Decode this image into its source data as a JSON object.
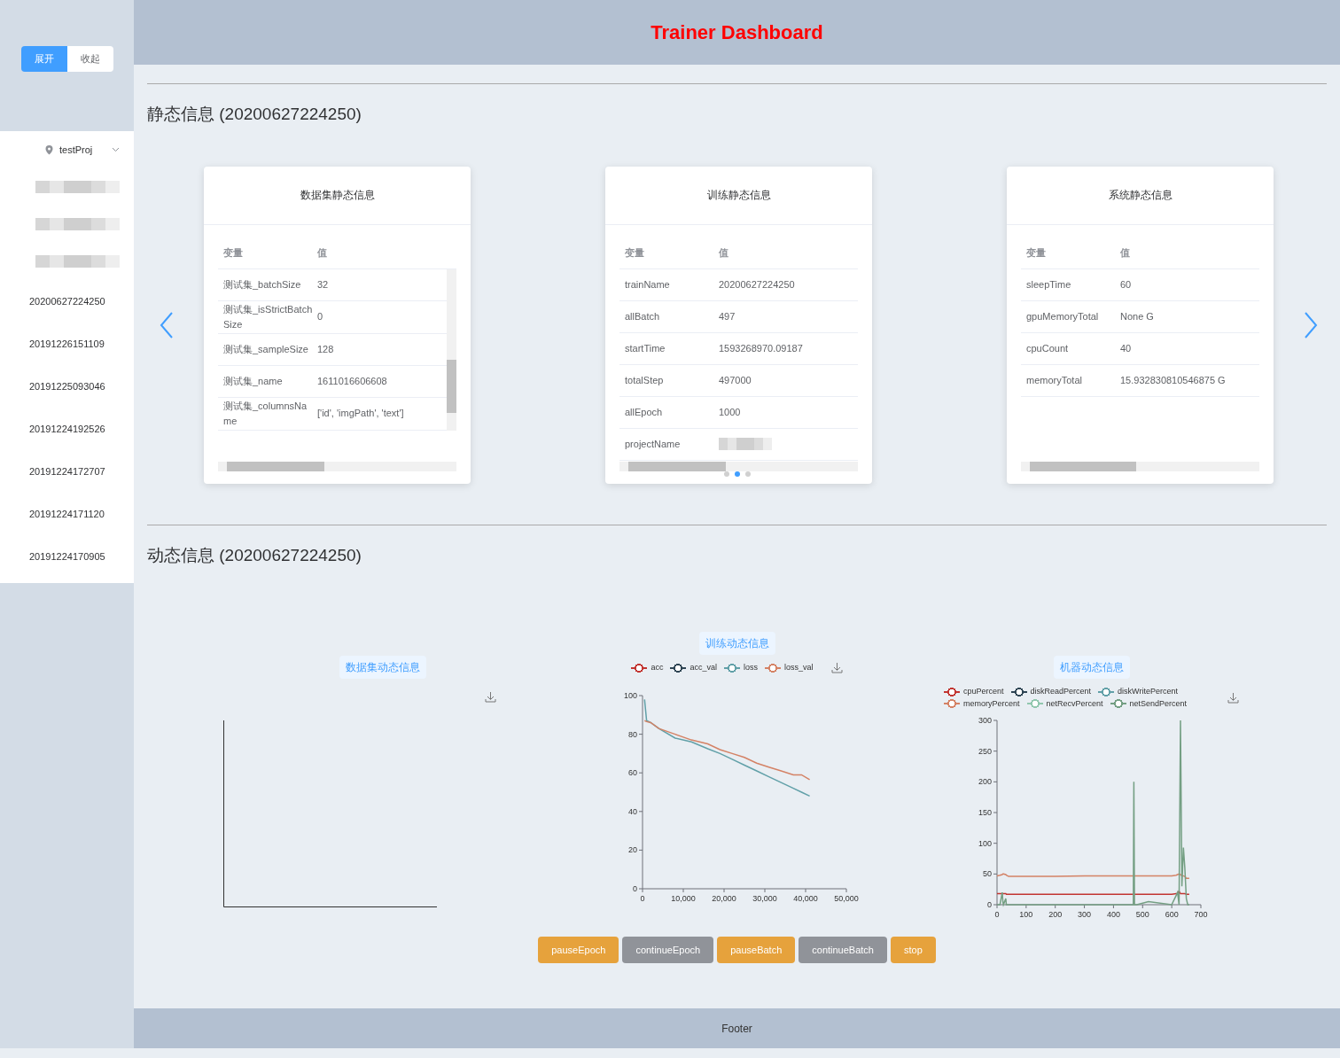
{
  "header": {
    "title": "Trainer Dashboard"
  },
  "sidebar": {
    "toggle": [
      {
        "label": "展开",
        "selected": true
      },
      {
        "label": "收起",
        "selected": false
      }
    ],
    "project": "testProj",
    "menu": [
      {
        "kind": "redacted"
      },
      {
        "kind": "redacted"
      },
      {
        "kind": "redacted"
      },
      {
        "kind": "run",
        "label": "20200627224250"
      },
      {
        "kind": "run",
        "label": "20191226151109"
      },
      {
        "kind": "run",
        "label": "20191225093046"
      },
      {
        "kind": "run",
        "label": "20191224192526"
      },
      {
        "kind": "run",
        "label": "20191224172707"
      },
      {
        "kind": "run",
        "label": "20191224171120"
      },
      {
        "kind": "run",
        "label": "20191224170905"
      }
    ]
  },
  "static_section": {
    "title": "静态信息 (20200627224250)",
    "cards": [
      {
        "title": "数据集静态信息",
        "columns": [
          "变量",
          "值"
        ],
        "vertical_scrollbar": true,
        "rows": [
          {
            "key": "测试集_batchSize",
            "value": "32"
          },
          {
            "key": "测试集_isStrictBatchSize",
            "value": "0"
          },
          {
            "key": "测试集_sampleSize",
            "value": "128"
          },
          {
            "key": "测试集_name",
            "value": "1611016606608"
          },
          {
            "key": "测试集_columnsName",
            "value": "['id', 'imgPath', 'text']"
          }
        ]
      },
      {
        "title": "训练静态信息",
        "columns": [
          "变量",
          "值"
        ],
        "rows": [
          {
            "key": "trainName",
            "value": "20200627224250"
          },
          {
            "key": "allBatch",
            "value": "497"
          },
          {
            "key": "startTime",
            "value": "1593268970.09187"
          },
          {
            "key": "totalStep",
            "value": "497000"
          },
          {
            "key": "allEpoch",
            "value": "1000"
          },
          {
            "key": "projectName"
          }
        ]
      },
      {
        "title": "系统静态信息",
        "columns": [
          "变量",
          "值"
        ],
        "rows": [
          {
            "key": "sleepTime",
            "value": "60"
          },
          {
            "key": "gpuMemoryTotal",
            "value": "None G"
          },
          {
            "key": "cpuCount",
            "value": "40"
          },
          {
            "key": "memoryTotal",
            "value": "15.932830810546875 G"
          }
        ]
      }
    ],
    "dots": [
      {
        "selected": false
      },
      {
        "selected": true
      },
      {
        "selected": false
      }
    ]
  },
  "dynamic_section": {
    "title": "动态信息 (20200627224250)",
    "panels": [
      {
        "title": "数据集动态信息",
        "kind": "empty"
      },
      {
        "title": "训练动态信息",
        "kind": "chart",
        "chart_data": {
          "type": "line",
          "x": [
            500,
            1000,
            2000,
            4000,
            8000,
            12000,
            16000,
            19000,
            22000,
            25000,
            28000,
            31000,
            34000,
            37000,
            39000,
            41000
          ],
          "series": [
            {
              "name": "acc",
              "color": "#c23531",
              "values": [
                null,
                null,
                null,
                null,
                null,
                null,
                null,
                null,
                null,
                null,
                null,
                null,
                null,
                null,
                null,
                null
              ]
            },
            {
              "name": "acc_val",
              "color": "#2f4554",
              "values": [
                null,
                null,
                null,
                null,
                null,
                null,
                null,
                null,
                null,
                null,
                null,
                null,
                null,
                null,
                null,
                null
              ]
            },
            {
              "name": "loss",
              "color": "#61a0a8",
              "values": [
                98,
                87,
                86,
                83,
                78,
                76,
                72.5,
                70,
                67,
                64,
                61,
                58,
                55,
                52,
                50,
                48
              ]
            },
            {
              "name": "loss_val",
              "color": "#d48265",
              "values": [
                87,
                86.5,
                86,
                83,
                80,
                77,
                75,
                72,
                70,
                68,
                65,
                63,
                61,
                59,
                59,
                56.5
              ]
            }
          ],
          "xlim": [
            0,
            50000
          ],
          "ylim": [
            0,
            100
          ],
          "xticks": [
            0,
            {
              "value": 10000,
              "label": "10,000"
            },
            {
              "value": 20000,
              "label": "20,000"
            },
            {
              "value": 30000,
              "label": "30,000"
            },
            {
              "value": 40000,
              "label": "40,000"
            },
            {
              "value": 50000,
              "label": "50,000"
            }
          ],
          "yticks": [
            0,
            20,
            40,
            60,
            80,
            100
          ]
        }
      },
      {
        "title": "机器动态信息",
        "kind": "chart",
        "chart_data": {
          "type": "line",
          "x": [
            0,
            10,
            18,
            20,
            22,
            30,
            32,
            40,
            100,
            200,
            300,
            400,
            460,
            468,
            470,
            472,
            480,
            520,
            600,
            615,
            620,
            625,
            630,
            635,
            640,
            645,
            650,
            655,
            660
          ],
          "series": [
            {
              "name": "cpuPercent",
              "color": "#c23531",
              "values": [
                18,
                18,
                18,
                18,
                18,
                18,
                17,
                17,
                17,
                17,
                17,
                17,
                17,
                17,
                17,
                17,
                17,
                17,
                17,
                18,
                18,
                22,
                18,
                18,
                18,
                18,
                17,
                17,
                17
              ]
            },
            {
              "name": "diskReadPercent",
              "color": "#2f4554",
              "values": [
                null,
                null,
                null,
                null,
                null,
                null,
                null,
                null,
                null,
                null,
                null,
                null,
                null,
                null,
                null,
                null,
                null,
                null,
                null,
                null,
                null,
                null,
                null,
                null,
                null,
                null,
                null,
                null,
                null
              ]
            },
            {
              "name": "diskWritePercent",
              "color": "#61a0a8",
              "values": [
                null,
                null,
                null,
                null,
                null,
                null,
                null,
                null,
                null,
                null,
                null,
                null,
                null,
                null,
                null,
                null,
                null,
                null,
                null,
                null,
                null,
                null,
                null,
                null,
                null,
                null,
                null,
                null,
                null
              ]
            },
            {
              "name": "memoryPercent",
              "color": "#d48265",
              "values": [
                47,
                48,
                49,
                50,
                50,
                49,
                48,
                46,
                46,
                46,
                47,
                47,
                47,
                47,
                47,
                47,
                47,
                47,
                47,
                48,
                49,
                50,
                49,
                47,
                47,
                46,
                43,
                43,
                43
              ]
            },
            {
              "name": "netRecvPercent",
              "color": "#91c7ae",
              "values": [
                null,
                null,
                null,
                null,
                null,
                null,
                null,
                null,
                null,
                null,
                null,
                null,
                null,
                null,
                null,
                null,
                null,
                null,
                null,
                null,
                null,
                null,
                null,
                null,
                null,
                null,
                null,
                null,
                null
              ]
            },
            {
              "name": "netSendPercent",
              "color": "#749f83",
              "values": [
                0,
                0,
                20,
                5,
                0,
                10,
                0,
                0,
                0,
                0,
                0,
                0,
                0,
                0,
                200,
                0,
                0,
                5,
                0,
                15,
                20,
                0,
                300,
                30,
                93,
                60,
                10,
                0,
                0
              ]
            }
          ],
          "xlim": [
            0,
            700
          ],
          "ylim": [
            0,
            300
          ],
          "xticks": [
            0,
            100,
            200,
            300,
            400,
            500,
            600,
            700
          ],
          "yticks": [
            0,
            50,
            100,
            150,
            200,
            250,
            300
          ]
        }
      }
    ],
    "buttons": [
      {
        "label": "pauseEpoch",
        "kind": "warning"
      },
      {
        "label": "continueEpoch",
        "kind": "info"
      },
      {
        "label": "pauseBatch",
        "kind": "warning"
      },
      {
        "label": "continueBatch",
        "kind": "info"
      },
      {
        "label": "stop",
        "kind": "warning"
      }
    ]
  },
  "footer": {
    "text": "Footer"
  }
}
